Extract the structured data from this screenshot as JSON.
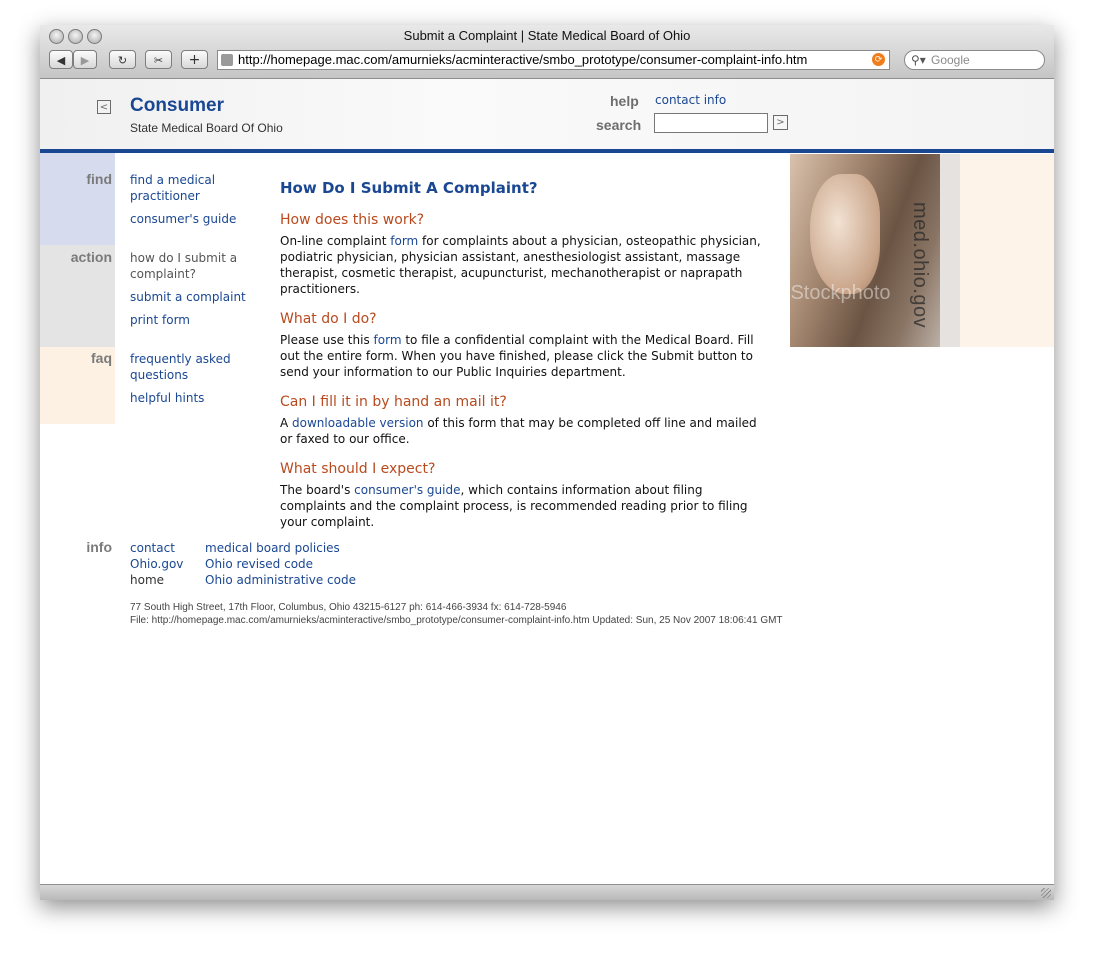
{
  "window": {
    "title": "Submit a Complaint | State Medical Board of Ohio",
    "url": "http://homepage.mac.com/amurnieks/acminteractive/smbo_prototype/consumer-complaint-info.htm",
    "search_placeholder": "Google"
  },
  "header": {
    "title": "Consumer",
    "subtitle": "State Medical Board Of Ohio",
    "help_label": "help",
    "help_link": "contact info",
    "search_label": "search"
  },
  "nav": {
    "find": {
      "label": "find",
      "items": [
        "find a medical practitioner",
        "consumer's guide"
      ]
    },
    "action": {
      "label": "action",
      "current": "how do I submit a complaint?",
      "items": [
        "submit a complaint",
        "print form"
      ]
    },
    "faq": {
      "label": "faq",
      "items": [
        "frequently asked questions",
        "helpful hints"
      ]
    }
  },
  "main": {
    "title": "How Do I Submit A Complaint?",
    "sections": [
      {
        "heading": "How does this work?",
        "pre": "On-line complaint ",
        "link": "form",
        "post": " for complaints about a physician, osteopathic physician, podiatric physician, physician assistant, anesthesiologist assistant, massage therapist, cosmetic therapist, acupuncturist, mechanotherapist or naprapath practitioners."
      },
      {
        "heading": "What do I do?",
        "pre": "Please use this ",
        "link": "form",
        "post": " to file a confidential complaint with the Medical Board. Fill out the entire form. When you have finished, please click the Submit button to send your information to our Public Inquiries department."
      },
      {
        "heading": "Can I fill it in by hand an mail it?",
        "pre": "A ",
        "link": "downloadable version",
        "post": " of this form that may be completed off line and mailed or faxed to our office."
      },
      {
        "heading": "What should I expect?",
        "pre": "The board's ",
        "link": "consumer's guide",
        "post": ", which contains information about filing complaints and the complaint process, is recommended reading prior to filing your complaint."
      }
    ]
  },
  "photo": {
    "vertical_text": "med.ohio.gov",
    "watermark": "iStockphoto"
  },
  "footer": {
    "label": "info",
    "col1": {
      "link1": "contact",
      "link2": "Ohio.gov",
      "static": "home"
    },
    "col2": [
      "medical board policies",
      "Ohio revised code",
      "Ohio administrative code"
    ],
    "address": "77 South High Street, 17th Floor, Columbus, Ohio 43215-6127 ph: 614-466-3934 fx: 614-728-5946",
    "file_info": "File: http://homepage.mac.com/amurnieks/acminteractive/smbo_prototype/consumer-complaint-info.htm Updated: Sun, 25 Nov 2007 18:06:41 GMT"
  },
  "colors": {
    "brand_blue": "#1a4792",
    "heading_orange": "#b84a1e",
    "find_band": "#d6dcee",
    "action_band": "#e4e4e4",
    "faq_band": "#fdf1e3"
  }
}
